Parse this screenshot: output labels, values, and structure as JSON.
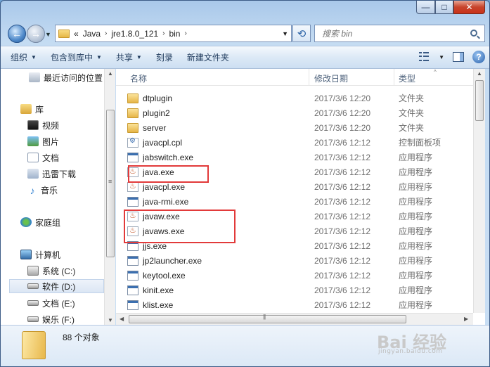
{
  "window": {
    "caption_min": "—",
    "caption_max": "□",
    "caption_close": "✕"
  },
  "address": {
    "breadcrumb_prefix": "«",
    "crumbs": [
      "Java",
      "jre1.8.0_121",
      "bin"
    ],
    "separator": "›"
  },
  "search": {
    "placeholder": "搜索 bin"
  },
  "toolbar": {
    "organize": "组织",
    "include_library": "包含到库中",
    "share": "共享",
    "burn": "刻录",
    "new_folder": "新建文件夹",
    "help": "?"
  },
  "sidebar": {
    "recent": "最近访问的位置",
    "library": "库",
    "videos": "视频",
    "pictures": "图片",
    "documents": "文档",
    "thunder": "迅雷下载",
    "music": "音乐",
    "homegroup": "家庭组",
    "computer": "计算机",
    "drive_c": "系统 (C:)",
    "drive_d": "软件 (D:)",
    "drive_e": "文档 (E:)",
    "drive_f": "娱乐 (F:)"
  },
  "columns": {
    "name": "名称",
    "date": "修改日期",
    "type": "类型"
  },
  "files": [
    {
      "name": "dtplugin",
      "date": "2017/3/6 12:20",
      "type": "文件夹",
      "icon": "folder-icon"
    },
    {
      "name": "plugin2",
      "date": "2017/3/6 12:20",
      "type": "文件夹",
      "icon": "folder-icon"
    },
    {
      "name": "server",
      "date": "2017/3/6 12:20",
      "type": "文件夹",
      "icon": "folder-icon"
    },
    {
      "name": "javacpl.cpl",
      "date": "2017/3/6 12:12",
      "type": "控制面板项",
      "icon": "control-panel-icon"
    },
    {
      "name": "jabswitch.exe",
      "date": "2017/3/6 12:12",
      "type": "应用程序",
      "icon": "exe-icon"
    },
    {
      "name": "java.exe",
      "date": "2017/3/6 12:12",
      "type": "应用程序",
      "icon": "java-icon"
    },
    {
      "name": "javacpl.exe",
      "date": "2017/3/6 12:12",
      "type": "应用程序",
      "icon": "java-icon"
    },
    {
      "name": "java-rmi.exe",
      "date": "2017/3/6 12:12",
      "type": "应用程序",
      "icon": "exe-icon"
    },
    {
      "name": "javaw.exe",
      "date": "2017/3/6 12:12",
      "type": "应用程序",
      "icon": "java-icon"
    },
    {
      "name": "javaws.exe",
      "date": "2017/3/6 12:12",
      "type": "应用程序",
      "icon": "java-icon"
    },
    {
      "name": "jjs.exe",
      "date": "2017/3/6 12:12",
      "type": "应用程序",
      "icon": "exe-icon"
    },
    {
      "name": "jp2launcher.exe",
      "date": "2017/3/6 12:12",
      "type": "应用程序",
      "icon": "exe-icon"
    },
    {
      "name": "keytool.exe",
      "date": "2017/3/6 12:12",
      "type": "应用程序",
      "icon": "exe-icon"
    },
    {
      "name": "kinit.exe",
      "date": "2017/3/6 12:12",
      "type": "应用程序",
      "icon": "exe-icon"
    },
    {
      "name": "klist.exe",
      "date": "2017/3/6 12:12",
      "type": "应用程序",
      "icon": "exe-icon"
    }
  ],
  "details": {
    "count": "88 个对象"
  },
  "watermark": {
    "brand": "Bai 经验",
    "url": "jingyan.baidu.com"
  },
  "colors": {
    "highlight": "#e23a3a",
    "titlebar": "#a9c8ea",
    "close_button": "#c7442c"
  }
}
